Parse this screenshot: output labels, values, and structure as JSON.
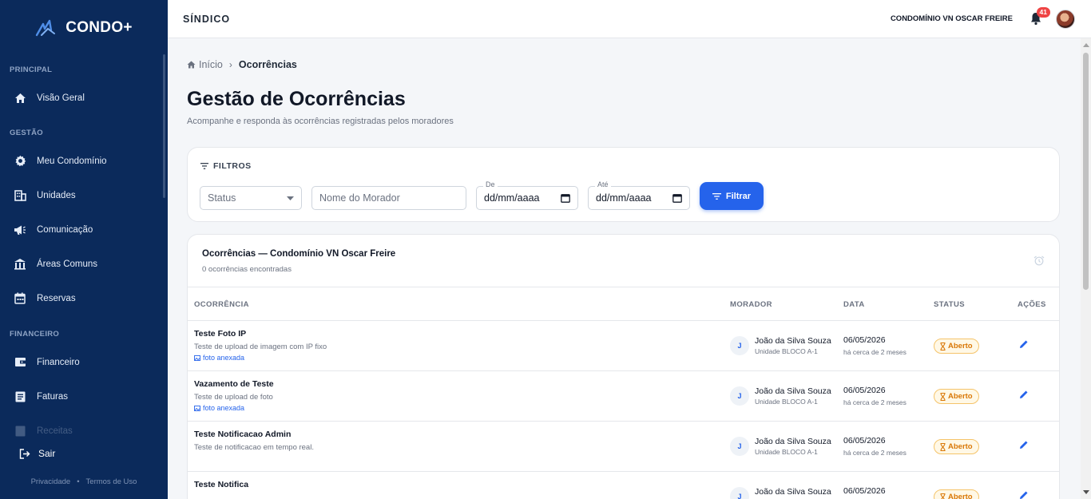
{
  "sidebar": {
    "brand": "CONDO+",
    "sections": [
      {
        "title": "PRINCIPAL",
        "items": [
          {
            "label": "Visão Geral",
            "icon": "home-icon"
          }
        ]
      },
      {
        "title": "GESTÃO",
        "items": [
          {
            "label": "Meu Condomínio",
            "icon": "gear-icon"
          },
          {
            "label": "Unidades",
            "icon": "building-icon"
          },
          {
            "label": "Comunicação",
            "icon": "megaphone-icon"
          },
          {
            "label": "Áreas Comuns",
            "icon": "common-area-icon"
          },
          {
            "label": "Reservas",
            "icon": "calendar-icon"
          }
        ]
      },
      {
        "title": "FINANCEIRO",
        "items": [
          {
            "label": "Financeiro",
            "icon": "wallet-icon"
          },
          {
            "label": "Faturas",
            "icon": "invoice-icon"
          },
          {
            "label": "Receitas",
            "icon": "receipt-icon"
          }
        ]
      }
    ],
    "logout": "Sair",
    "privacy": "Privacidade",
    "separator": "•",
    "terms": "Termos de Uso"
  },
  "header": {
    "title": "SÍNDICO",
    "condo_name": "CONDOMÍNIO VN OSCAR FREIRE",
    "notification_count": "41"
  },
  "breadcrumb": {
    "home": "Início",
    "separator": "›",
    "current": "Ocorrências"
  },
  "page": {
    "title": "Gestão de Ocorrências",
    "subtitle": "Acompanhe e responda às ocorrências registradas pelos moradores"
  },
  "filters": {
    "title": "FILTROS",
    "status_placeholder": "Status",
    "resident_placeholder": "Nome do Morador",
    "from_label": "De",
    "to_label": "Até",
    "date_placeholder": "dd/mm/aaaa",
    "button": "Filtrar"
  },
  "table": {
    "title": "Ocorrências — Condomínio VN Oscar Freire",
    "count": "0 ocorrências encontradas",
    "headers": {
      "occurrence": "OCORRÊNCIA",
      "resident": "MORADOR",
      "date": "DATA",
      "status": "STATUS",
      "actions": "AÇÕES"
    },
    "rows": [
      {
        "title": "Teste Foto IP",
        "description": "Teste de upload de imagem com IP fixo",
        "photo": "foto anexada",
        "resident_initial": "J",
        "resident": "João da Silva Souza",
        "unit": "Unidade BLOCO A-1",
        "date": "06/05/2026",
        "relative": "há cerca de 2 meses",
        "status": "Aberto"
      },
      {
        "title": "Vazamento de Teste",
        "description": "Teste de upload de foto",
        "photo": "foto anexada",
        "resident_initial": "J",
        "resident": "João da Silva Souza",
        "unit": "Unidade BLOCO A-1",
        "date": "06/05/2026",
        "relative": "há cerca de 2 meses",
        "status": "Aberto"
      },
      {
        "title": "Teste Notificacao Admin",
        "description": "Teste de notificacao em tempo real.",
        "photo": "",
        "resident_initial": "J",
        "resident": "João da Silva Souza",
        "unit": "Unidade BLOCO A-1",
        "date": "06/05/2026",
        "relative": "há cerca de 2 meses",
        "status": "Aberto"
      },
      {
        "title": "Teste Notifica",
        "description": "",
        "photo": "",
        "resident_initial": "J",
        "resident": "João da Silva Souza",
        "unit": "",
        "date": "06/05/2026",
        "relative": "",
        "status": "Aberto"
      }
    ]
  },
  "colors": {
    "sidebar": "#0b2a5b",
    "accent": "#2563eb",
    "status_open": "#d97706",
    "badge": "#ef4444"
  }
}
